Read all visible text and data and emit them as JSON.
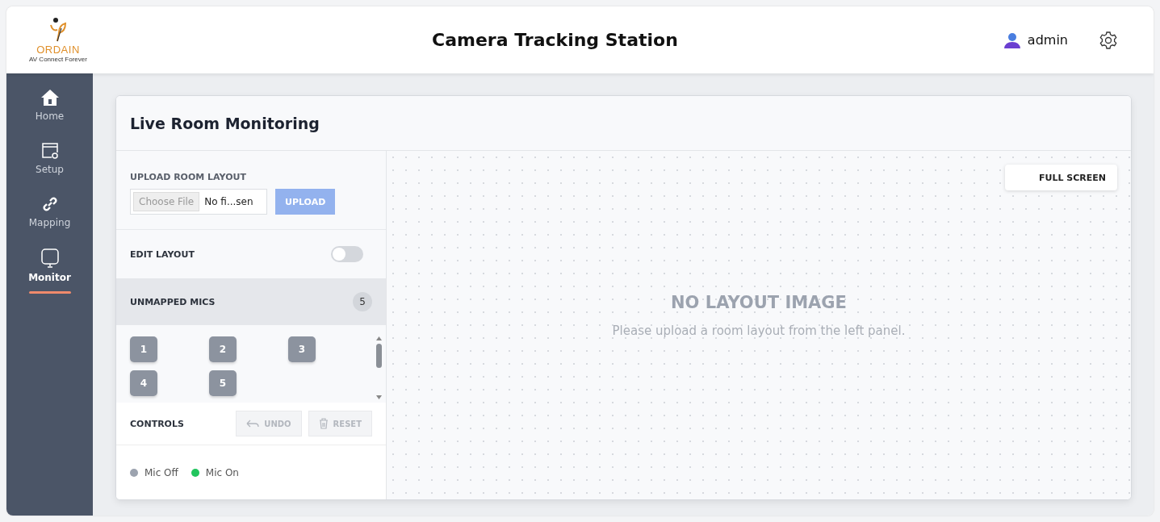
{
  "header": {
    "logo_text": "ORDAIN",
    "logo_tagline": "AV Connect Forever",
    "title": "Camera Tracking Station",
    "user": "admin"
  },
  "sidebar": {
    "items": [
      {
        "label": "Home",
        "kind": "home",
        "selected": false
      },
      {
        "label": "Setup",
        "kind": "setup",
        "selected": false
      },
      {
        "label": "Mapping",
        "kind": "link",
        "selected": false
      },
      {
        "label": "Monitor",
        "kind": "monitor",
        "selected": true
      }
    ]
  },
  "card": {
    "title": "Live Room Monitoring",
    "upload": {
      "label": "UPLOAD ROOM LAYOUT",
      "choose_button": "Choose File",
      "file_name": "No fi...sen",
      "upload_button": "UPLOAD"
    },
    "edit_layout": {
      "label": "EDIT LAYOUT",
      "on": false
    },
    "unmapped_mics": {
      "label": "UNMAPPED MICS",
      "count": "5",
      "mics": [
        "1",
        "2",
        "3",
        "4",
        "5"
      ]
    },
    "controls": {
      "label": "CONTROLS",
      "undo": "UNDO",
      "reset": "RESET"
    },
    "legend": [
      {
        "label": "Mic Off",
        "color": "#9ca3af"
      },
      {
        "label": "Mic On",
        "color": "#22c55e"
      }
    ],
    "canvas": {
      "full_screen": "FULL SCREEN",
      "empty_title": "NO LAYOUT IMAGE",
      "empty_text": "Please upload a room layout from the left panel."
    }
  }
}
